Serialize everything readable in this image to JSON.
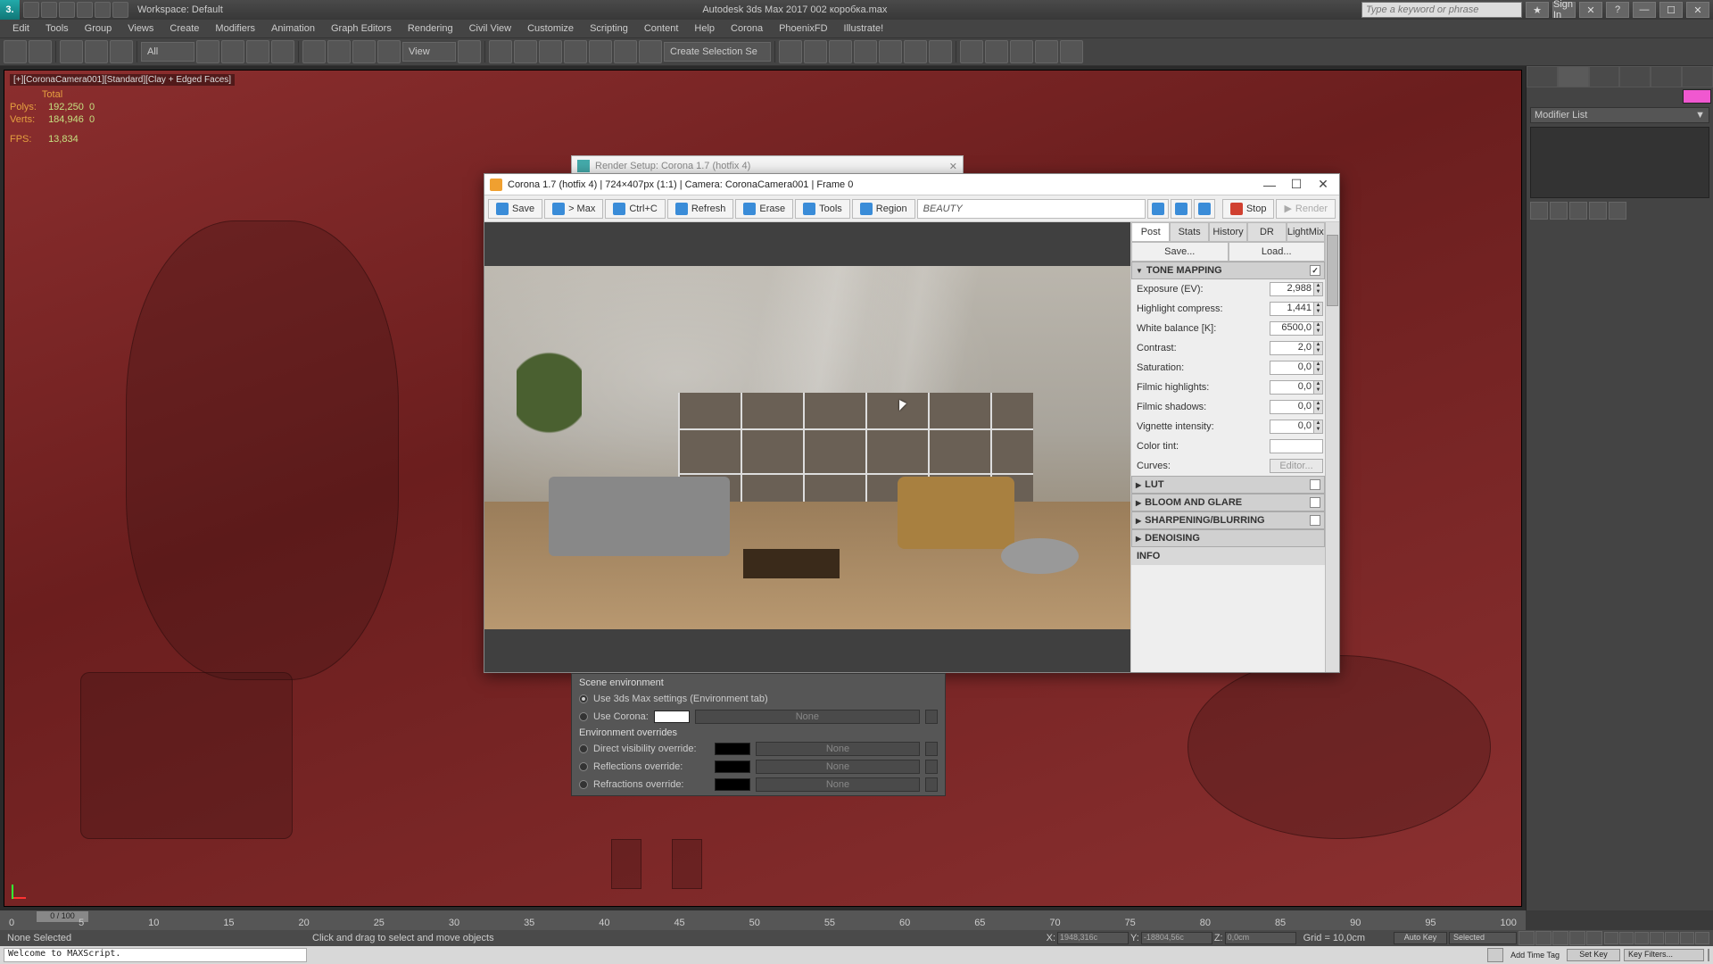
{
  "app": {
    "logo_text": "3.",
    "workspace_label": "Workspace: Default",
    "title": "Autodesk 3ds Max 2017   002 коробка.max",
    "search_placeholder": "Type a keyword or phrase",
    "signin": "Sign In"
  },
  "menu": [
    "Edit",
    "Tools",
    "Group",
    "Views",
    "Create",
    "Modifiers",
    "Animation",
    "Graph Editors",
    "Rendering",
    "Civil View",
    "Customize",
    "Scripting",
    "Content",
    "Help",
    "Corona",
    "PhoenixFD",
    "Illustrate!"
  ],
  "toolbar": {
    "filter_all": "All",
    "view_label": "View",
    "sel_set": "Create Selection Se"
  },
  "viewport": {
    "label": "[+][CoronaCamera001][Standard][Clay + Edged Faces]",
    "stats": {
      "total_label": "Total",
      "polys_label": "Polys:",
      "polys": "192,250",
      "polys2": "0",
      "verts_label": "Verts:",
      "verts": "184,946",
      "verts2": "0",
      "fps_label": "FPS:",
      "fps": "13,834"
    }
  },
  "cmdpanel": {
    "modifier_list": "Modifier List"
  },
  "rsetup_stub": "Render Setup: Corona 1.7 (hotfix 4)",
  "vfb": {
    "title": "Corona 1.7 (hotfix 4) | 724×407px (1:1) | Camera: CoronaCamera001 | Frame 0",
    "btns": {
      "save": "Save",
      "max": "> Max",
      "ctrlc": "Ctrl+C",
      "refresh": "Refresh",
      "erase": "Erase",
      "tools": "Tools",
      "region": "Region",
      "stop": "Stop",
      "render": "Render"
    },
    "channel": "BEAUTY",
    "tabs": [
      "Post",
      "Stats",
      "History",
      "DR",
      "LightMix"
    ],
    "saveload": {
      "save": "Save...",
      "load": "Load..."
    },
    "sections": {
      "tone": "TONE MAPPING",
      "lut": "LUT",
      "bloom": "BLOOM AND GLARE",
      "sharp": "SHARPENING/BLURRING",
      "denoise": "DENOISING",
      "info": "INFO"
    },
    "params": {
      "exposure": {
        "label": "Exposure (EV):",
        "value": "2,988"
      },
      "highlight": {
        "label": "Highlight compress:",
        "value": "1,441"
      },
      "whitebal": {
        "label": "White balance [K]:",
        "value": "6500,0"
      },
      "contrast": {
        "label": "Contrast:",
        "value": "2,0"
      },
      "saturation": {
        "label": "Saturation:",
        "value": "0,0"
      },
      "filmic_h": {
        "label": "Filmic highlights:",
        "value": "0,0"
      },
      "filmic_s": {
        "label": "Filmic shadows:",
        "value": "0,0"
      },
      "vignette": {
        "label": "Vignette intensity:",
        "value": "0,0"
      },
      "colortint": {
        "label": "Color tint:"
      },
      "curves": {
        "label": "Curves:",
        "editor": "Editor..."
      }
    }
  },
  "scene_env": {
    "title": "Scene environment",
    "use_max": "Use 3ds Max settings (Environment tab)",
    "use_corona": "Use Corona:",
    "overrides_title": "Environment overrides",
    "direct": "Direct visibility override:",
    "refl": "Reflections override:",
    "refr": "Refractions override:",
    "none": "None"
  },
  "timeline": {
    "frame": "0 / 100",
    "ticks": [
      "0",
      "5",
      "10",
      "15",
      "20",
      "25",
      "30",
      "35",
      "40",
      "45",
      "50",
      "55",
      "60",
      "65",
      "70",
      "75",
      "80",
      "85",
      "90",
      "95",
      "100"
    ]
  },
  "status": {
    "selection": "None Selected",
    "prompt": "Click and drag to select and move objects",
    "x_label": "X:",
    "x": "1948,316c",
    "y_label": "Y:",
    "y": "-18804,56c",
    "z_label": "Z:",
    "z": "0,0cm",
    "grid": "Grid = 10,0cm",
    "autokey": "Auto Key",
    "selected": "Selected",
    "setkey": "Set Key",
    "keyfilters": "Key Filters...",
    "addtag": "Add Time Tag",
    "script": "Welcome to MAXScript."
  }
}
